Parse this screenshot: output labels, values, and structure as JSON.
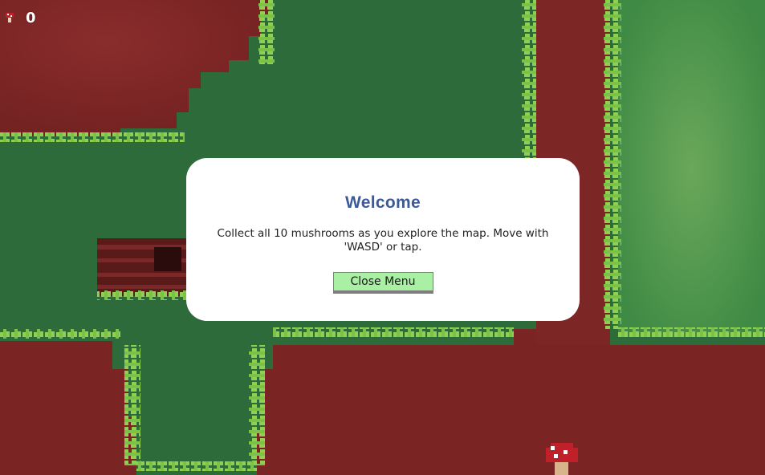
{
  "hud": {
    "mushroom_icon": "mushroom-icon",
    "collected_count": "0"
  },
  "dialog": {
    "title": "Welcome",
    "message": "Collect all 10 mushrooms as you explore the map. Move with 'WASD' or tap.",
    "close_label": "Close Menu"
  },
  "colors": {
    "dirt": "#7a2424",
    "dirt_dark": "#5c1a1a",
    "grass": "#2d6b3a",
    "grass_light": "#5a9a4e",
    "grass_edge": "#8fd14f",
    "dialog_title": "#3a5a9a",
    "button_bg": "#a9f0a4",
    "mushroom_cap": "#c0202a",
    "mushroom_stem": "#d9b38c"
  }
}
